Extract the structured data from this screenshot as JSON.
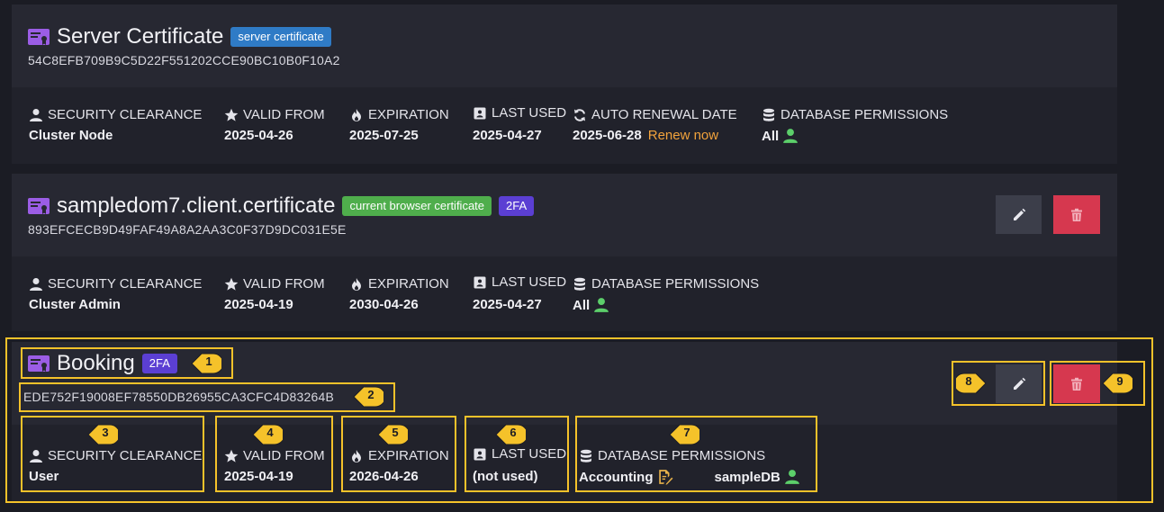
{
  "colors": {
    "accent_purple": "#9b5de5",
    "badge_blue": "#2f7bc6",
    "badge_green": "#4fae4c",
    "badge_purple": "#5b3fd3",
    "renew_orange": "#f2a33c",
    "delete_red": "#d6384f",
    "highlight_yellow": "#f5c22a",
    "user_green": "#5ccf6a"
  },
  "labels": {
    "security_clearance": "SECURITY CLEARANCE",
    "valid_from": "VALID FROM",
    "expiration": "EXPIRATION",
    "last_used": "LAST USED",
    "auto_renewal_date": "AUTO RENEWAL DATE",
    "database_permissions": "DATABASE PERMISSIONS"
  },
  "certificates": [
    {
      "name": "Server Certificate",
      "badges": [
        "server certificate"
      ],
      "thumbprint": "54C8EFB709B9C5D22F551202CCE90BC10B0F10A2",
      "security_clearance": "Cluster Node",
      "valid_from": "2025-04-26",
      "expiration": "2025-07-25",
      "last_used": "2025-04-27",
      "auto_renewal_date": "2025-06-28",
      "renew_link": "Renew now",
      "database_permissions": "All"
    },
    {
      "name": "sampledom7.client.certificate",
      "badges": [
        "current browser certificate",
        "2FA"
      ],
      "thumbprint": "893EFCECB9D49FAF49A8A2AA3C0F37D9DC031E5E",
      "security_clearance": "Cluster Admin",
      "valid_from": "2025-04-19",
      "expiration": "2030-04-26",
      "last_used": "2025-04-27",
      "database_permissions": "All"
    },
    {
      "name": "Booking",
      "badges": [
        "2FA"
      ],
      "thumbprint": "EDE752F19008EF78550DB26955CA3CFC4D83264B",
      "security_clearance": "User",
      "valid_from": "2025-04-19",
      "expiration": "2026-04-26",
      "last_used": "(not used)",
      "database_permissions": [
        {
          "db": "Accounting",
          "access": "edit"
        },
        {
          "db": "sampleDB",
          "access": "user"
        }
      ]
    }
  ],
  "markers": [
    "1",
    "2",
    "3",
    "4",
    "5",
    "6",
    "7",
    "8",
    "9"
  ]
}
